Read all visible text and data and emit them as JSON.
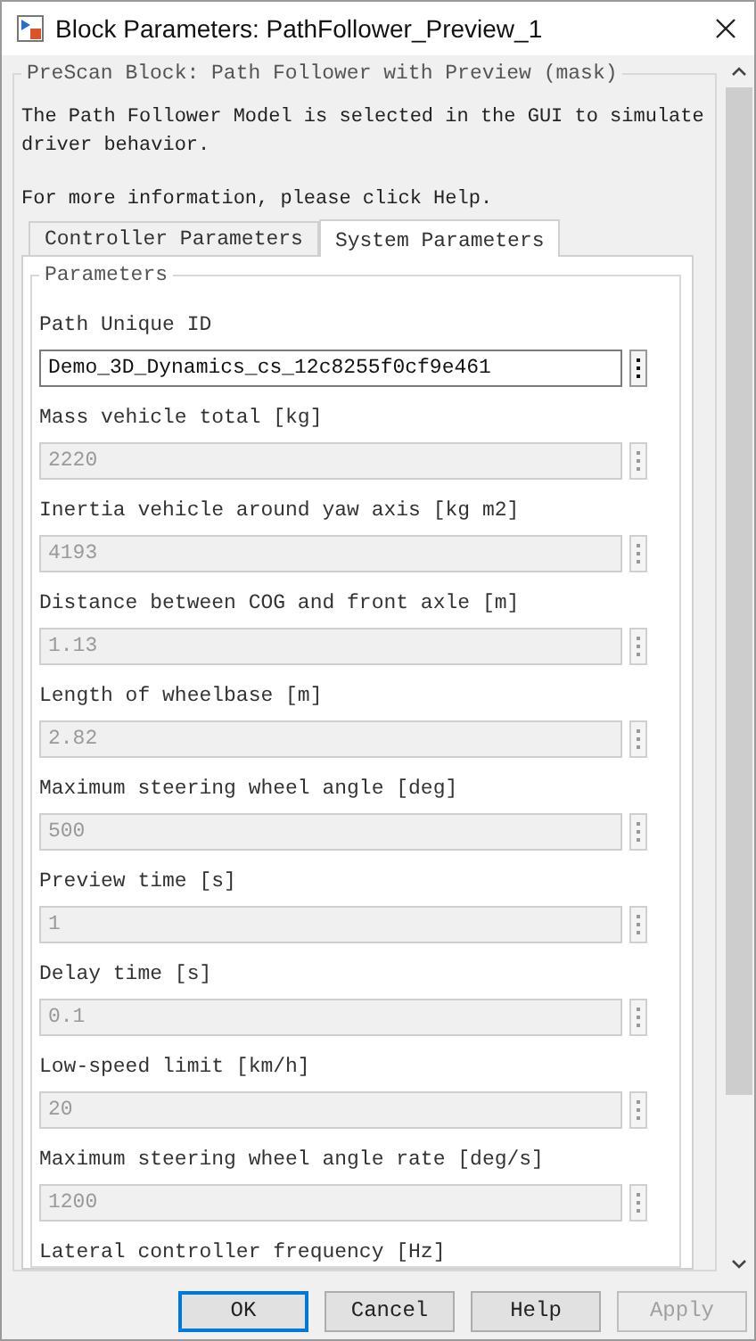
{
  "window": {
    "title": "Block Parameters: PathFollower_Preview_1"
  },
  "mask": {
    "title": "PreScan Block: Path Follower with Preview (mask)",
    "description": "The Path Follower Model is selected in the GUI to simulate driver behavior.",
    "help_note": "For more information, please click Help."
  },
  "tabs": [
    {
      "label": "Controller Parameters",
      "selected": false
    },
    {
      "label": "System Parameters",
      "selected": true
    }
  ],
  "group": {
    "title": "Parameters"
  },
  "parameters": [
    {
      "label": "Path Unique ID",
      "value": "Demo_3D_Dynamics_cs_12c8255f0cf9e461",
      "disabled": false
    },
    {
      "label": "Mass vehicle total [kg]",
      "value": "2220",
      "disabled": true
    },
    {
      "label": "Inertia vehicle around yaw axis [kg m2]",
      "value": "4193",
      "disabled": true
    },
    {
      "label": "Distance between COG and front axle [m]",
      "value": "1.13",
      "disabled": true
    },
    {
      "label": "Length of wheelbase [m]",
      "value": "2.82",
      "disabled": true
    },
    {
      "label": "Maximum steering wheel angle [deg]",
      "value": "500",
      "disabled": true
    },
    {
      "label": "Preview time [s]",
      "value": "1",
      "disabled": true
    },
    {
      "label": "Delay time [s]",
      "value": "0.1",
      "disabled": true
    },
    {
      "label": "Low-speed limit [km/h]",
      "value": "20",
      "disabled": true
    },
    {
      "label": "Maximum steering wheel angle rate [deg/s]",
      "value": "1200",
      "disabled": true
    },
    {
      "label": "Lateral controller frequency [Hz]"
    }
  ],
  "buttons": [
    {
      "label": "OK",
      "default": true,
      "disabled": false
    },
    {
      "label": "Cancel",
      "default": false,
      "disabled": false
    },
    {
      "label": "Help",
      "default": false,
      "disabled": false
    },
    {
      "label": "Apply",
      "default": false,
      "disabled": true
    }
  ]
}
